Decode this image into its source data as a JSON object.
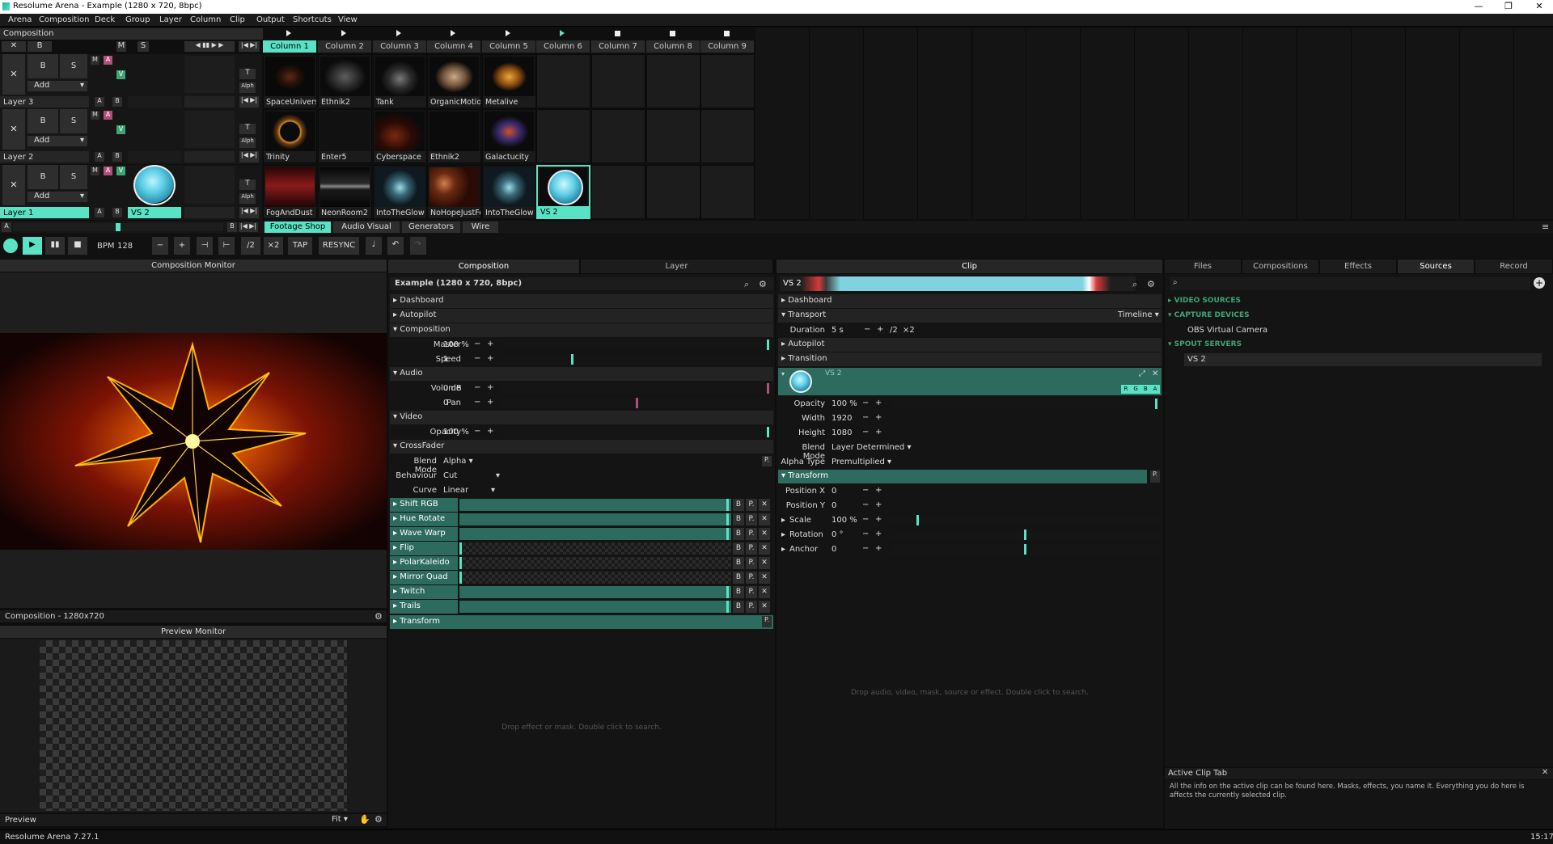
{
  "window": {
    "title": "Resolume Arena - Example (1280 x 720, 8bpc)"
  },
  "menu": [
    "Arena",
    "Composition",
    "Deck",
    "Group",
    "Layer",
    "Column",
    "Clip",
    "Output",
    "Shortcuts",
    "View"
  ],
  "composition_label": "Composition",
  "columns": [
    "Column 1",
    "Column 2",
    "Column 3",
    "Column 4",
    "Column 5",
    "Column 6",
    "Column 7",
    "Column 8",
    "Column 9"
  ],
  "layers": [
    {
      "name": "Layer 3",
      "clips": [
        "SpaceUniverse",
        "Ethnik2",
        "Tank",
        "OrganicMotions",
        "Metalive"
      ]
    },
    {
      "name": "Layer 2",
      "clips": [
        "Trinity",
        "Enter5",
        "Cyberspace",
        "Ethnik2",
        "Galactucity"
      ]
    },
    {
      "name": "Layer 1",
      "clips": [
        "FogAndDust",
        "NeonRoom2",
        "IntoTheGlow",
        "NoHopeJustFear",
        "IntoTheGlow",
        "VS 2"
      ],
      "active_clip": "VS 2"
    }
  ],
  "layer_controls": {
    "x": "✕",
    "b": "B",
    "s": "S",
    "m": "M",
    "a": "A",
    "v": "V",
    "add": "Add",
    "ab_a": "A",
    "ab_b": "B",
    "t": "T",
    "alph": "Alph"
  },
  "header_controls": {
    "x": "✕",
    "b": "B",
    "m": "M",
    "s": "S"
  },
  "deck_row": {
    "a": "A",
    "b": "B",
    "tabs": [
      "Footage Shop",
      "Audio Visual",
      "Generators",
      "Wire"
    ]
  },
  "transport": {
    "bpm_label": "BPM",
    "bpm": "128",
    "minus": "−",
    "plus": "+",
    "div": "/2",
    "mult": "×2",
    "tap": "TAP",
    "resync": "RESYNC"
  },
  "comp_monitor": {
    "title": "Composition Monitor",
    "footer": "Composition - 1280x720"
  },
  "preview_monitor": {
    "title": "Preview Monitor",
    "footer": "Preview",
    "fit": "Fit"
  },
  "mid_tabs": [
    "Composition",
    "Layer"
  ],
  "composition_panel": {
    "name": "Example (1280 x 720, 8bpc)",
    "sections": [
      "Dashboard",
      "Autopilot",
      "Composition"
    ],
    "master_label": "Master",
    "master": "100 %",
    "master_level": 0.99,
    "speed_label": "Speed",
    "speed": "1",
    "speed_level": 0.26,
    "audio_label": "Audio",
    "volume_label": "Volume",
    "volume": "0 dB",
    "volume_level": 0.99,
    "pan_label": "Pan",
    "pan": "0",
    "pan_level": 0.5,
    "video_label": "Video",
    "opacity_label": "Opacity",
    "opacity": "100 %",
    "opacity_level": 0.99,
    "crossfader_label": "CrossFader",
    "blend_label": "Blend Mode",
    "blend": "Alpha",
    "p": "P.",
    "behaviour_label": "Behaviour",
    "behaviour": "Cut",
    "curve_label": "Curve",
    "curve": "Linear",
    "effects": [
      {
        "name": "Shift RGB",
        "level": 0.99,
        "style": "plain"
      },
      {
        "name": "Hue Rotate",
        "level": 0.99,
        "style": "plain"
      },
      {
        "name": "Wave Warp",
        "level": 0.99,
        "style": "plain"
      },
      {
        "name": "Flip",
        "level": 0.0,
        "style": "checker"
      },
      {
        "name": "PolarKaleido",
        "level": 0.0,
        "style": "checker"
      },
      {
        "name": "Mirror Quad",
        "level": 0.0,
        "style": "checker"
      },
      {
        "name": "Twitch",
        "level": 0.99,
        "style": "plain"
      },
      {
        "name": "Trails",
        "level": 0.99,
        "style": "plain"
      }
    ],
    "eff_b": "B",
    "eff_p": "P.",
    "eff_x": "✕",
    "transform_label": "Transform",
    "drop_hint": "Drop effect or mask. Double click to search."
  },
  "clip_panel": {
    "tab": "Clip",
    "name": "VS 2",
    "dashboard": "Dashboard",
    "transport": "Transport",
    "timeline": "Timeline",
    "duration_label": "Duration",
    "duration": "5 s",
    "div": "/2",
    "mult": "×2",
    "autopilot": "Autopilot",
    "transition": "Transition",
    "source_name": "VS 2",
    "rgba": [
      "R",
      "G",
      "B",
      "A"
    ],
    "opacity_label": "Opacity",
    "opacity": "100 %",
    "opacity_level": 0.99,
    "width_label": "Width",
    "width": "1920",
    "height_label": "Height",
    "height": "1080",
    "blend_label": "Blend Mode",
    "blend": "Layer Determined",
    "alpha_label": "Alpha Type",
    "alpha": "Premultiplied",
    "transform_label": "Transform",
    "p": "P.",
    "posx_label": "Position X",
    "posx": "0",
    "posy_label": "Position Y",
    "posy": "0",
    "scale_label": "Scale",
    "scale": "100 %",
    "scale_level": 0.1,
    "rotation_label": "Rotation",
    "rotation": "0 °",
    "rotation_level": 0.5,
    "anchor_label": "Anchor",
    "anchor": "0",
    "anchor_level": 0.5,
    "drop_hint": "Drop audio, video, mask, source or effect. Double click to search."
  },
  "browser": {
    "tabs": [
      "Files",
      "Compositions",
      "Effects",
      "Sources",
      "Record"
    ],
    "active_tab": "Sources",
    "groups": [
      {
        "title": "VIDEO SOURCES",
        "items": []
      },
      {
        "title": "CAPTURE DEVICES",
        "items": [
          "OBS Virtual Camera"
        ]
      },
      {
        "title": "SPOUT SERVERS",
        "items": [
          "VS 2"
        ]
      }
    ]
  },
  "help": {
    "title": "Active Clip Tab",
    "text": "All the info on the active clip can be found here. Masks, effects, you name it. Everything you do here is affects the currently selected clip."
  },
  "status": {
    "left": "Resolume Arena 7.27.1",
    "right": "15:17"
  },
  "colors": {
    "accent": "#59e3c4",
    "magenta": "#b04f7a",
    "green": "#3fa376",
    "effect_bar": "#2d6b5e"
  }
}
